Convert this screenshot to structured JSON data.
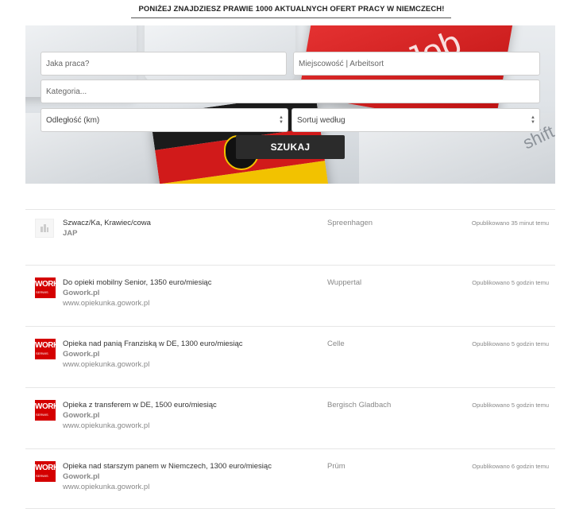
{
  "headline": "PONIŻEJ ZNAJDZIESZ PRAWIE 1000 AKTUALNYCH OFERT PRACY W NIEMCZECH!",
  "hero": {
    "key_text": "Job",
    "shift_text": "shift"
  },
  "search": {
    "job_placeholder": "Jaka praca?",
    "location_placeholder": "Miejscowość | Arbeitsort",
    "category_placeholder": "Kategoria...",
    "distance_label": "Odległość (km)",
    "sort_label": "Sortuj według",
    "submit_label": "SZUKAJ"
  },
  "jobs": [
    {
      "title": "Szwacz/Ka, Krawiec/cowa",
      "company": "JAP",
      "url": "",
      "location": "Spreenhagen",
      "posted": "Opublikowano 35 minut temu",
      "logo": "placeholder-icon"
    },
    {
      "title": "Do opieki mobilny Senior, 1350 euro/miesiąc",
      "company": "Gowork.pl",
      "url": "www.opiekunka.gowork.pl",
      "location": "Wuppertal",
      "posted": "Opublikowano 5 godzin temu",
      "logo": "gowork-logo"
    },
    {
      "title": "Opieka nad panią Franziską w DE, 1300 euro/miesiąc",
      "company": "Gowork.pl",
      "url": "www.opiekunka.gowork.pl",
      "location": "Celle",
      "posted": "Opublikowano 5 godzin temu",
      "logo": "gowork-logo"
    },
    {
      "title": "Opieka z transferem w DE, 1500 euro/miesiąc",
      "company": "Gowork.pl",
      "url": "www.opiekunka.gowork.pl",
      "location": "Bergisch Gladbach",
      "posted": "Opublikowano 5 godzin temu",
      "logo": "gowork-logo"
    },
    {
      "title": "Opieka nad starszym panem w Niemczech, 1300 euro/miesiąc",
      "company": "Gowork.pl",
      "url": "www.opiekunka.gowork.pl",
      "location": "Prüm",
      "posted": "Opublikowano 6 godzin temu",
      "logo": "gowork-logo"
    }
  ],
  "logo_text": {
    "top": "WORK",
    "bottom": "SERWIS"
  },
  "colors": {
    "accent_red": "#d40000",
    "button_dark": "#2b2b2b",
    "flag_black": "#1b1b1b",
    "flag_red": "#d11a1a",
    "flag_gold": "#f2c200"
  }
}
